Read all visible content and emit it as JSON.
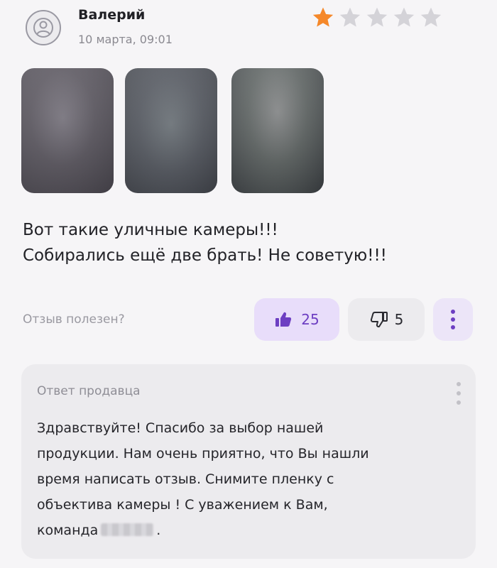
{
  "review": {
    "author": "Валерий",
    "date": "10 марта, 09:01",
    "rating": 1,
    "rating_max": 5,
    "photos_count": 3,
    "text_lines": [
      "Вот такие уличные камеры!!!",
      "Собирались ещё две брать! Не советую!!!"
    ],
    "helpful_question": "Отзыв полезен?",
    "likes": "25",
    "dislikes": "5"
  },
  "seller_reply": {
    "title": "Ответ продавца",
    "lines": [
      "Здравствуйте! Спасибо за выбор нашей",
      "продукции. Нам очень приятно, что Вы нашли",
      "время написать отзыв. Снимите пленку с",
      "объектива камеры ! С уважением к Вам,",
      "команда"
    ],
    "end_punct": "."
  },
  "colors": {
    "star_active": "#f5882a",
    "star_inactive": "#d4d3d8",
    "like_accent": "#6d3fc2",
    "like_bg": "#e8ddfa"
  },
  "icons": {
    "avatar": "user-icon",
    "like": "thumbs-up-icon",
    "dislike": "thumbs-down-icon",
    "more": "more-vertical-icon"
  }
}
